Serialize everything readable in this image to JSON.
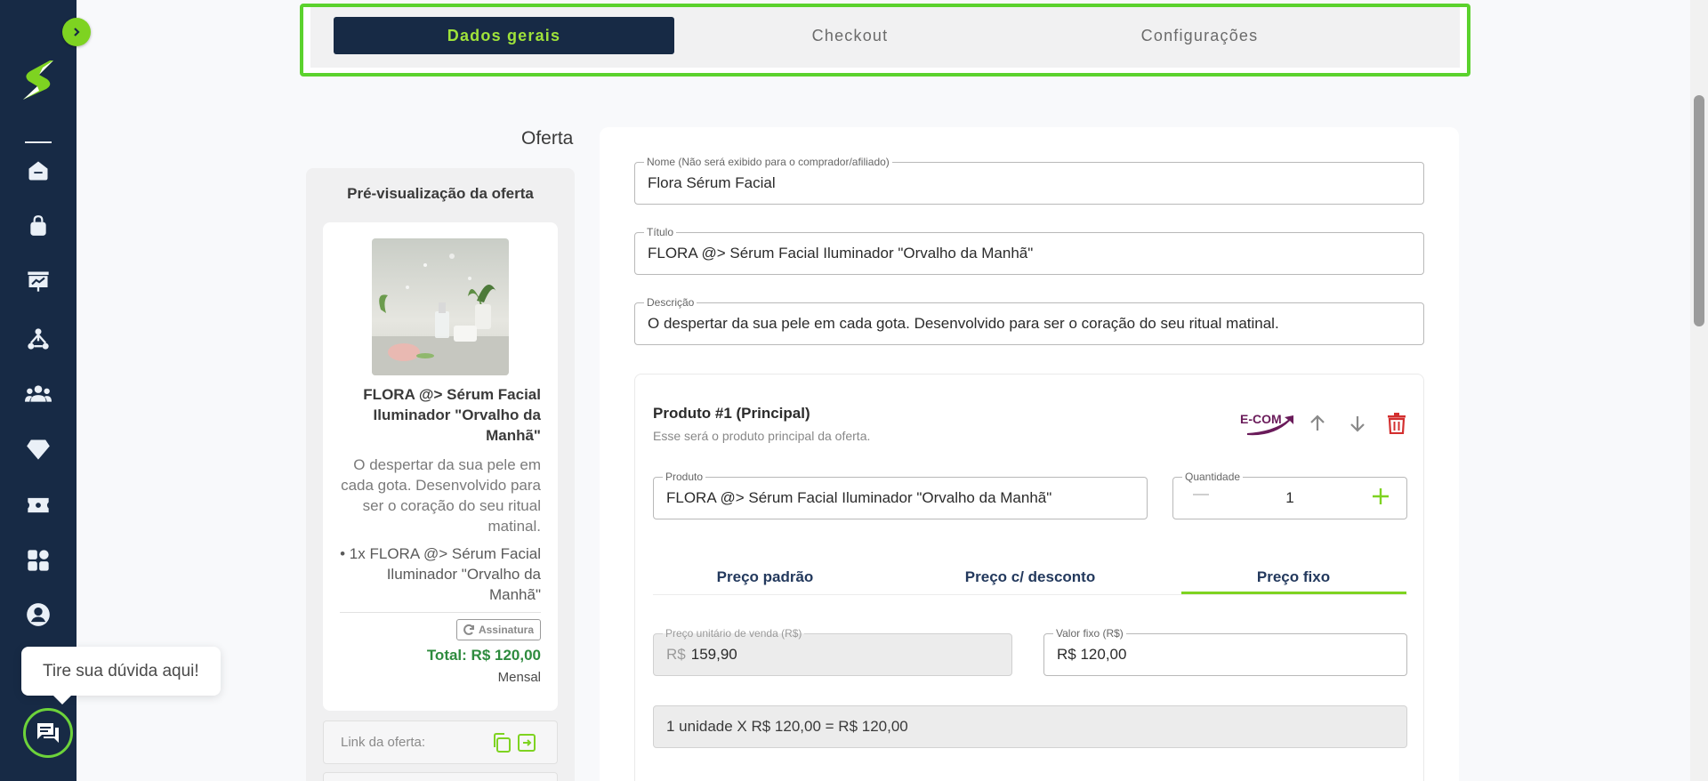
{
  "tabs": [
    {
      "label": "Dados gerais",
      "active": true
    },
    {
      "label": "Checkout",
      "active": false
    },
    {
      "label": "Configurações",
      "active": false
    }
  ],
  "section_title": "Oferta",
  "preview": {
    "heading": "Pré-visualização da oferta",
    "title": "FLORA @> Sérum Facial Iluminador \"Orvalho da Manhã\"",
    "description": "O despertar da sua pele em cada gota. Desenvolvido para ser o coração do seu ritual matinal.",
    "item": "• 1x FLORA @> Sérum Facial Iluminador \"Orvalho da Manhã\"",
    "badge": "Assinatura",
    "total": "Total: R$ 120,00",
    "period": "Mensal",
    "link_label": "Link da oferta:"
  },
  "form": {
    "name": {
      "label": "Nome (Não será exibido para o comprador/afiliado)",
      "value": "Flora Sérum Facial"
    },
    "title": {
      "label": "Título",
      "value": "FLORA @> Sérum Facial Iluminador \"Orvalho da Manhã\""
    },
    "description": {
      "label": "Descrição",
      "value": "O despertar da sua pele em cada gota. Desenvolvido para ser o coração do seu ritual matinal."
    }
  },
  "product": {
    "heading": "Produto #1 (Principal)",
    "subtitle": "Esse será o produto principal da oferta.",
    "brand_badge": "E-COM",
    "product_label": "Produto",
    "product_value": "FLORA @> Sérum Facial Iluminador \"Orvalho da Manhã\"",
    "qty_label": "Quantidade",
    "qty_value": "1",
    "price_tabs": [
      {
        "label": "Preço padrão",
        "active": false
      },
      {
        "label": "Preço c/ desconto",
        "active": false
      },
      {
        "label": "Preço fixo",
        "active": true
      }
    ],
    "unit_price_label": "Preço unitário de venda (R$)",
    "unit_price_prefix": "R$",
    "unit_price_value": "159,90",
    "fixed_value_label": "Valor fixo (R$)",
    "fixed_value": "R$ 120,00",
    "summary": "1 unidade X R$ 120,00 = R$ 120,00"
  },
  "help": {
    "text": "Tire sua dúvida aqui!"
  },
  "colors": {
    "sidebar": "#172a45",
    "accent_green": "#7ed321",
    "delete_red": "#d32f2f",
    "total_green": "#2e8b3e",
    "ecom_purple": "#6a1b5a"
  },
  "icons": [
    "chevron-right-icon",
    "home-icon",
    "bag-icon",
    "presentation-icon",
    "network-icon",
    "users-icon",
    "diamond-icon",
    "ticket-icon",
    "apps-icon",
    "account-icon",
    "arrow-up-icon",
    "arrow-down-icon",
    "trash-icon",
    "plus-icon",
    "copy-icon",
    "open-link-icon",
    "refresh-icon",
    "chat-icon"
  ]
}
